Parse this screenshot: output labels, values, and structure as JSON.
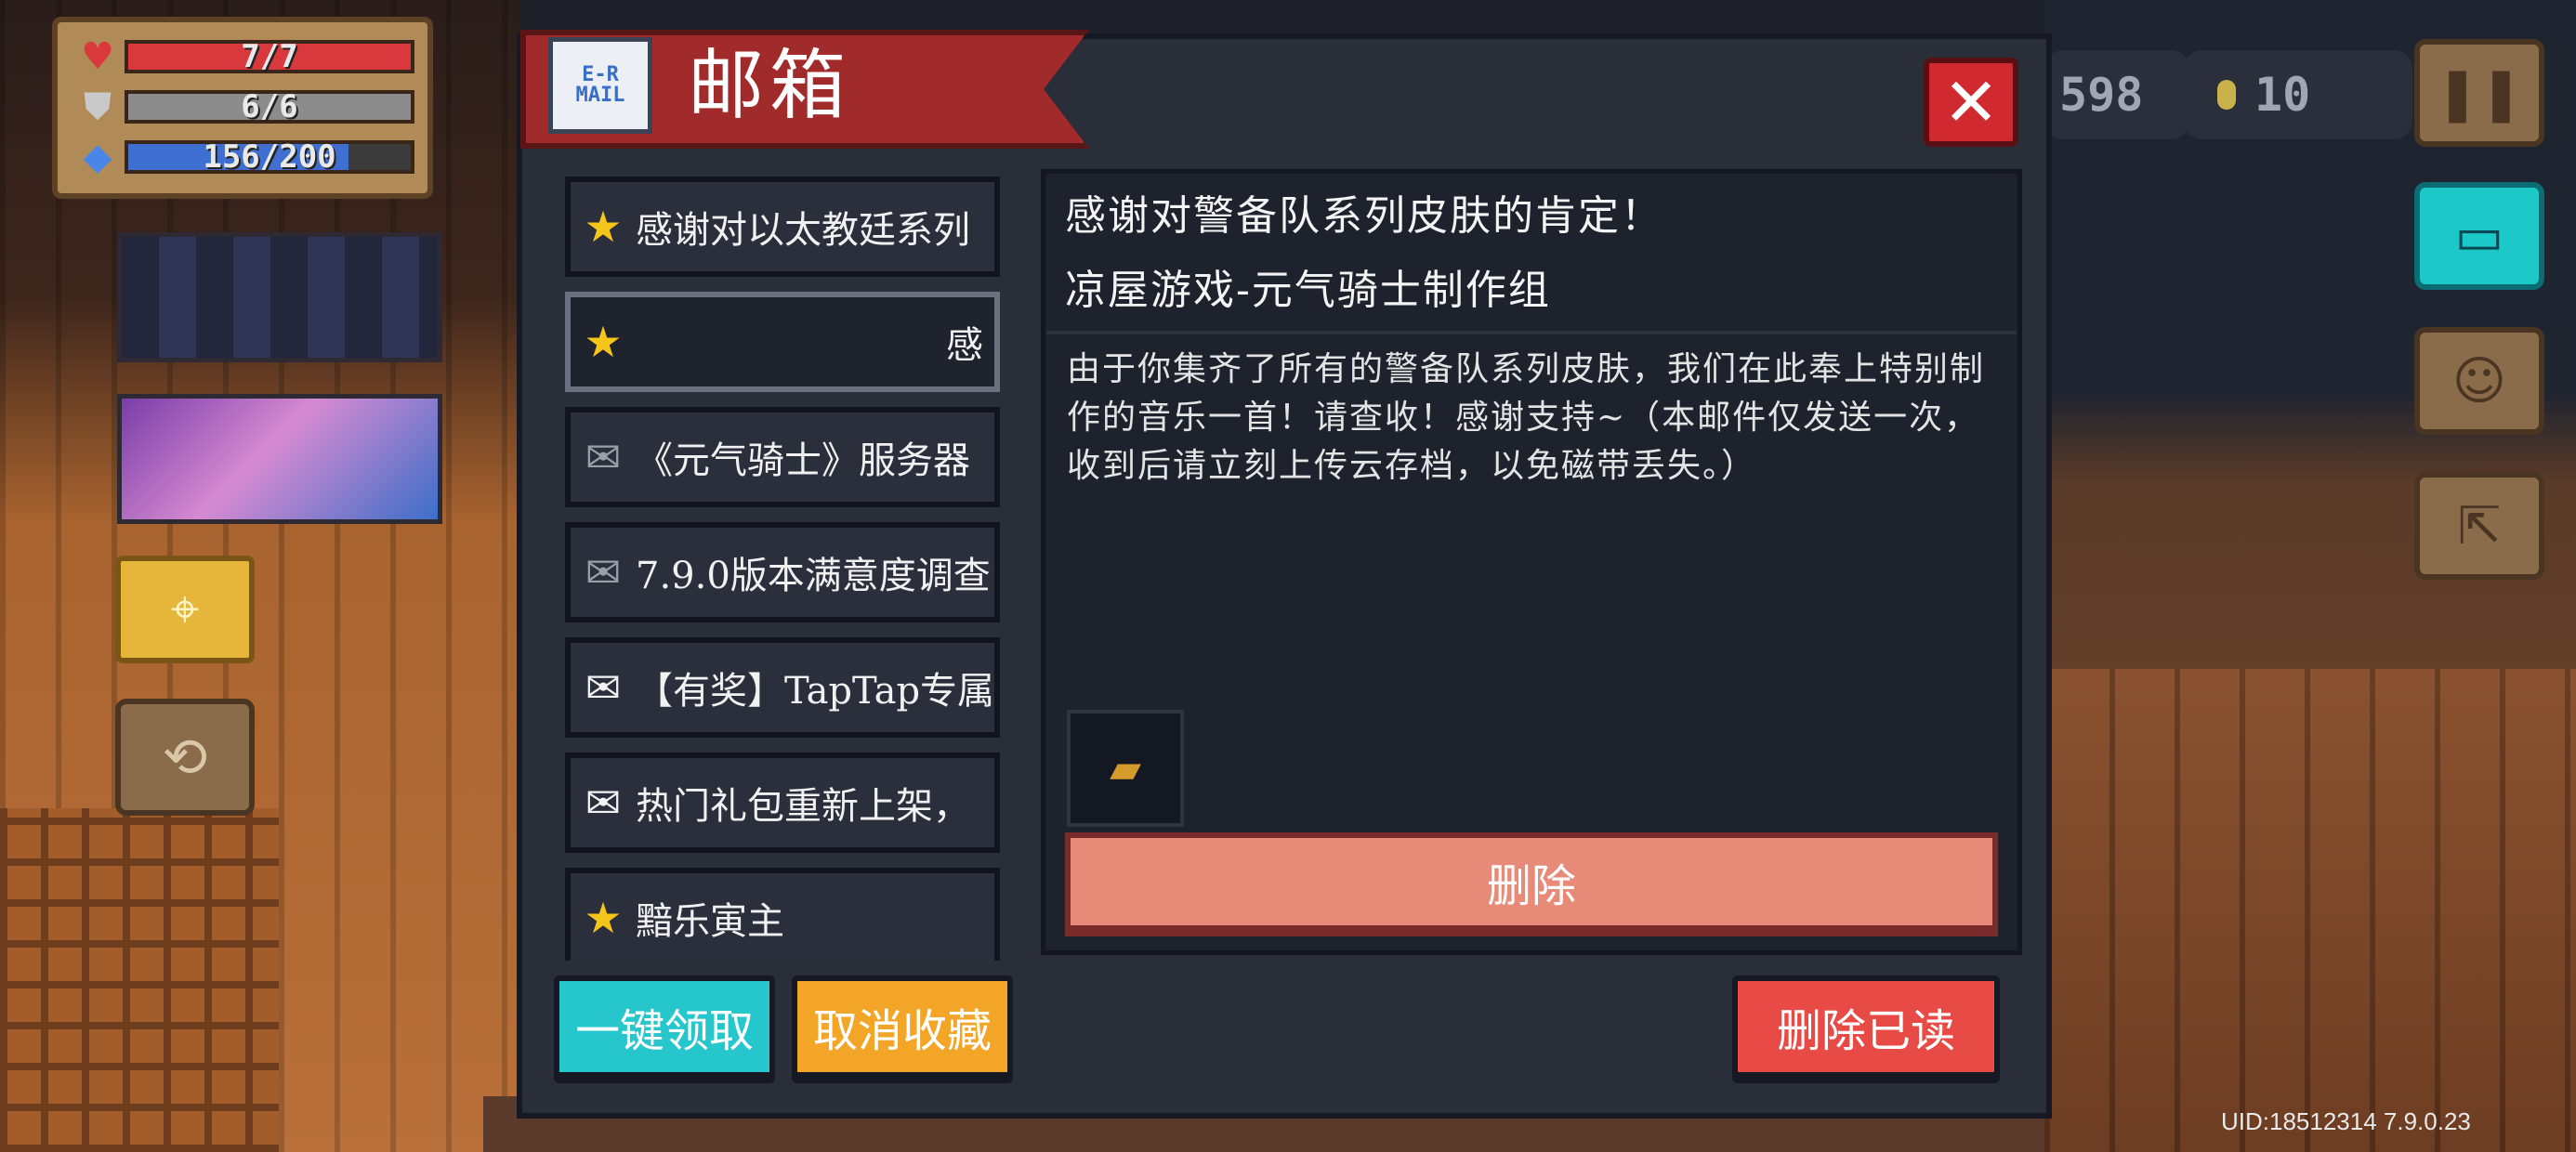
{
  "hud": {
    "health": {
      "text": "7/7",
      "fraction": 1.0,
      "color": "#d9383c",
      "icon": "heart-icon"
    },
    "armor": {
      "text": "6/6",
      "fraction": 1.0,
      "color": "#8c8c8c",
      "icon": "shield-icon"
    },
    "energy": {
      "text": "156/200",
      "fraction": 0.78,
      "color": "#3f6fd0",
      "icon": "diamond-icon"
    },
    "gems_text": "598",
    "coins_text": "10"
  },
  "mailbox": {
    "title": "邮箱",
    "icon_text": "E-R\nMAIL",
    "close_icon": "close-icon",
    "mails": [
      {
        "icon": "star-icon",
        "glyph": "★",
        "text": "感谢对以太教廷系列"
      },
      {
        "icon": "star-icon",
        "glyph": "★",
        "text": "感",
        "selected": true
      },
      {
        "icon": "open-envelope-icon",
        "glyph": "✉",
        "text": "《元气骑士》服务器"
      },
      {
        "icon": "open-envelope-icon",
        "glyph": "✉",
        "text": "7.9.0版本满意度调查"
      },
      {
        "icon": "envelope-icon",
        "glyph": "✉",
        "text": "【有奖】TapTap专属"
      },
      {
        "icon": "envelope-icon",
        "glyph": "✉",
        "text": "热门礼包重新上架，"
      },
      {
        "icon": "star-icon",
        "glyph": "★",
        "text": "黯乐寅主"
      }
    ],
    "detail": {
      "title": "感谢对警备队系列皮肤的肯定！",
      "sender": "凉屋游戏-元气骑士制作组",
      "body": "由于你集齐了所有的警备队系列皮肤，我们在此奉上特别制作的音乐一首！请查收！感谢支持~（本邮件仅发送一次，收到后请立刻上传云存档，以免磁带丢失。）",
      "attachment_icon": "cassette-tape-icon",
      "delete_label": "删除"
    },
    "buttons": {
      "claim_all": "一键领取",
      "unfavorite": "取消收藏",
      "delete_read": "删除已读"
    }
  },
  "footer": {
    "uid": "UID:18512314 7.9.0.23"
  }
}
